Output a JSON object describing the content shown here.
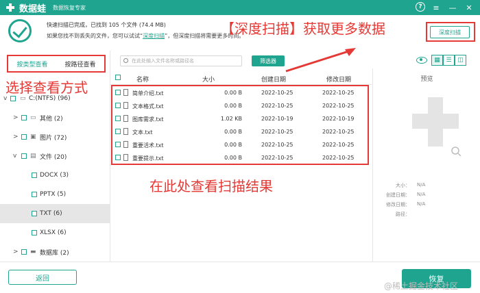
{
  "window": {
    "app_name": "数据蛙",
    "app_subtitle": "数据恢复专家",
    "icons": [
      "help-icon",
      "menu-icon",
      "minimize-icon",
      "close-icon"
    ],
    "icon_glyphs": {
      "help": "?",
      "menu": "≡",
      "minimize": "—",
      "close": "✕"
    }
  },
  "status": {
    "line1": "快速扫描已完成，已找到 105 个文件 (74.4 MB)",
    "line2_prefix": "如果您找不到丢失的文件，您可以试试“",
    "line2_link": "深度扫描",
    "line2_suffix": "”，但深度扫描将需要更多时间。",
    "deep_scan_button": "深度扫描"
  },
  "annotations": {
    "deep_scan": "【深度扫描】获取更多数据",
    "view_mode": "选择查看方式",
    "results": "在此处查看扫描结果"
  },
  "sidebar": {
    "tabs": [
      {
        "label": "按类型查看",
        "active": true
      },
      {
        "label": "按路径查看",
        "active": false
      }
    ],
    "tree": [
      {
        "label": "C:(NTFS) (96)",
        "chevron": "v",
        "icon": "drive-icon"
      },
      {
        "label": "其他 (2)",
        "chevron": ">",
        "icon": "folder-icon"
      },
      {
        "label": "图片 (72)",
        "chevron": ">",
        "icon": "image-icon"
      },
      {
        "label": "文件 (20)",
        "chevron": "v",
        "icon": "document-icon"
      },
      {
        "label": "DOCX (3)",
        "chevron": "",
        "icon": ""
      },
      {
        "label": "PPTX (5)",
        "chevron": "",
        "icon": ""
      },
      {
        "label": "TXT (6)",
        "chevron": "",
        "icon": "",
        "selected": true
      },
      {
        "label": "XLSX (6)",
        "chevron": "",
        "icon": ""
      },
      {
        "label": "数据库 (2)",
        "chevron": ">",
        "icon": "database-icon"
      }
    ]
  },
  "toolbar": {
    "search_placeholder": "在此处输入文件名称或路径名",
    "filter_button": "筛选器"
  },
  "table": {
    "headers": [
      "名称",
      "大小",
      "创建日期",
      "修改日期"
    ],
    "rows": [
      {
        "name": "简单介绍.txt",
        "size": "0.00 B",
        "created": "2022-10-25",
        "modified": "2022-10-25"
      },
      {
        "name": "文本格式.txt",
        "size": "0.00 B",
        "created": "2022-10-25",
        "modified": "2022-10-25"
      },
      {
        "name": "图库需求.txt",
        "size": "1.02 KB",
        "created": "2022-10-19",
        "modified": "2022-10-19"
      },
      {
        "name": "文本.txt",
        "size": "0.00 B",
        "created": "2022-10-25",
        "modified": "2022-10-25"
      },
      {
        "name": "重要活术.txt",
        "size": "0.00 B",
        "created": "2022-10-25",
        "modified": "2022-10-25"
      },
      {
        "name": "重要提示.txt",
        "size": "0.00 B",
        "created": "2022-10-25",
        "modified": "2022-10-25"
      }
    ]
  },
  "preview": {
    "title": "预览",
    "fields": [
      {
        "label": "大小：",
        "value": "N/A"
      },
      {
        "label": "创建日期：",
        "value": "N/A"
      },
      {
        "label": "修改日期：",
        "value": "N/A"
      },
      {
        "label": "路径：",
        "value": ""
      }
    ]
  },
  "footer": {
    "back_button": "返回",
    "recover_button": "恢复",
    "watermark": "@稀土掘金技术社区"
  },
  "colors": {
    "accent": "#1fa58f",
    "annotation": "#e53935"
  }
}
